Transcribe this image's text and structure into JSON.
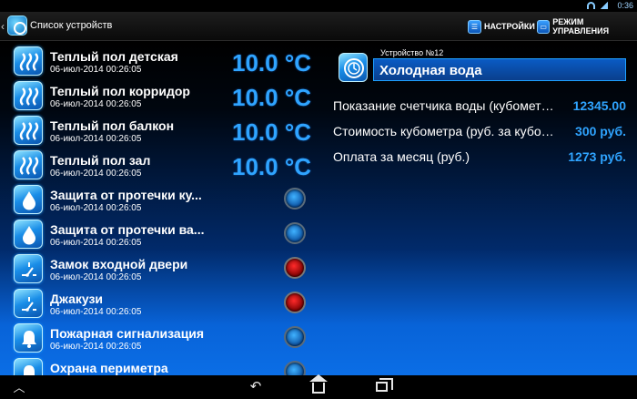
{
  "status_bar": {
    "time": "0:36"
  },
  "action_bar": {
    "title": "Список устройств",
    "settings_label": "НАСТРОЙКИ",
    "mode_label": "РЕЖИМ УПРАВЛЕНИЯ"
  },
  "devices": [
    {
      "name": "Теплый пол детская",
      "date": "06-июл-2014 00:26:05",
      "value": "10.0 °C",
      "icon": "heating-icon"
    },
    {
      "name": "Теплый пол корридор",
      "date": "06-июл-2014 00:26:05",
      "value": "10.0 °C",
      "icon": "heating-icon"
    },
    {
      "name": "Теплый пол балкон",
      "date": "06-июл-2014 00:26:05",
      "value": "10.0 °C",
      "icon": "heating-icon"
    },
    {
      "name": "Теплый пол зал",
      "date": "06-июл-2014 00:26:05",
      "value": "10.0 °C",
      "icon": "heating-icon"
    },
    {
      "name": "Защита от протечки ку...",
      "date": "06-июл-2014 00:26:05",
      "state": "blue",
      "icon": "water-drop-icon"
    },
    {
      "name": "Защита от протечки ва...",
      "date": "06-июл-2014 00:26:05",
      "state": "blue",
      "icon": "water-drop-icon"
    },
    {
      "name": "Замок входной двери",
      "date": "06-июл-2014 00:26:05",
      "state": "red",
      "icon": "switch-icon"
    },
    {
      "name": " Джакузи",
      "date": "06-июл-2014 00:26:05",
      "state": "red",
      "icon": "switch-icon"
    },
    {
      "name": "Пожарная сигнализация",
      "date": "06-июл-2014 00:26:05",
      "state": "blue",
      "icon": "bell-icon"
    },
    {
      "name": "Охрана периметра",
      "date": "",
      "state": "blue",
      "icon": "bell-icon"
    }
  ],
  "detail": {
    "device_number": "Устройство №12",
    "device_name": "Холодная вода",
    "properties": [
      {
        "label": "Показание счетчика воды (кубометры)",
        "value": "12345.00"
      },
      {
        "label": "Стоимость кубометра (руб. за кубометр)",
        "value": "300 руб."
      },
      {
        "label": "Оплата за месяц (руб.)",
        "value": "1273 руб."
      }
    ]
  },
  "colors": {
    "accent": "#2fa4ff",
    "alarm": "#ff2a2a",
    "panel": "#0a5bc4"
  }
}
